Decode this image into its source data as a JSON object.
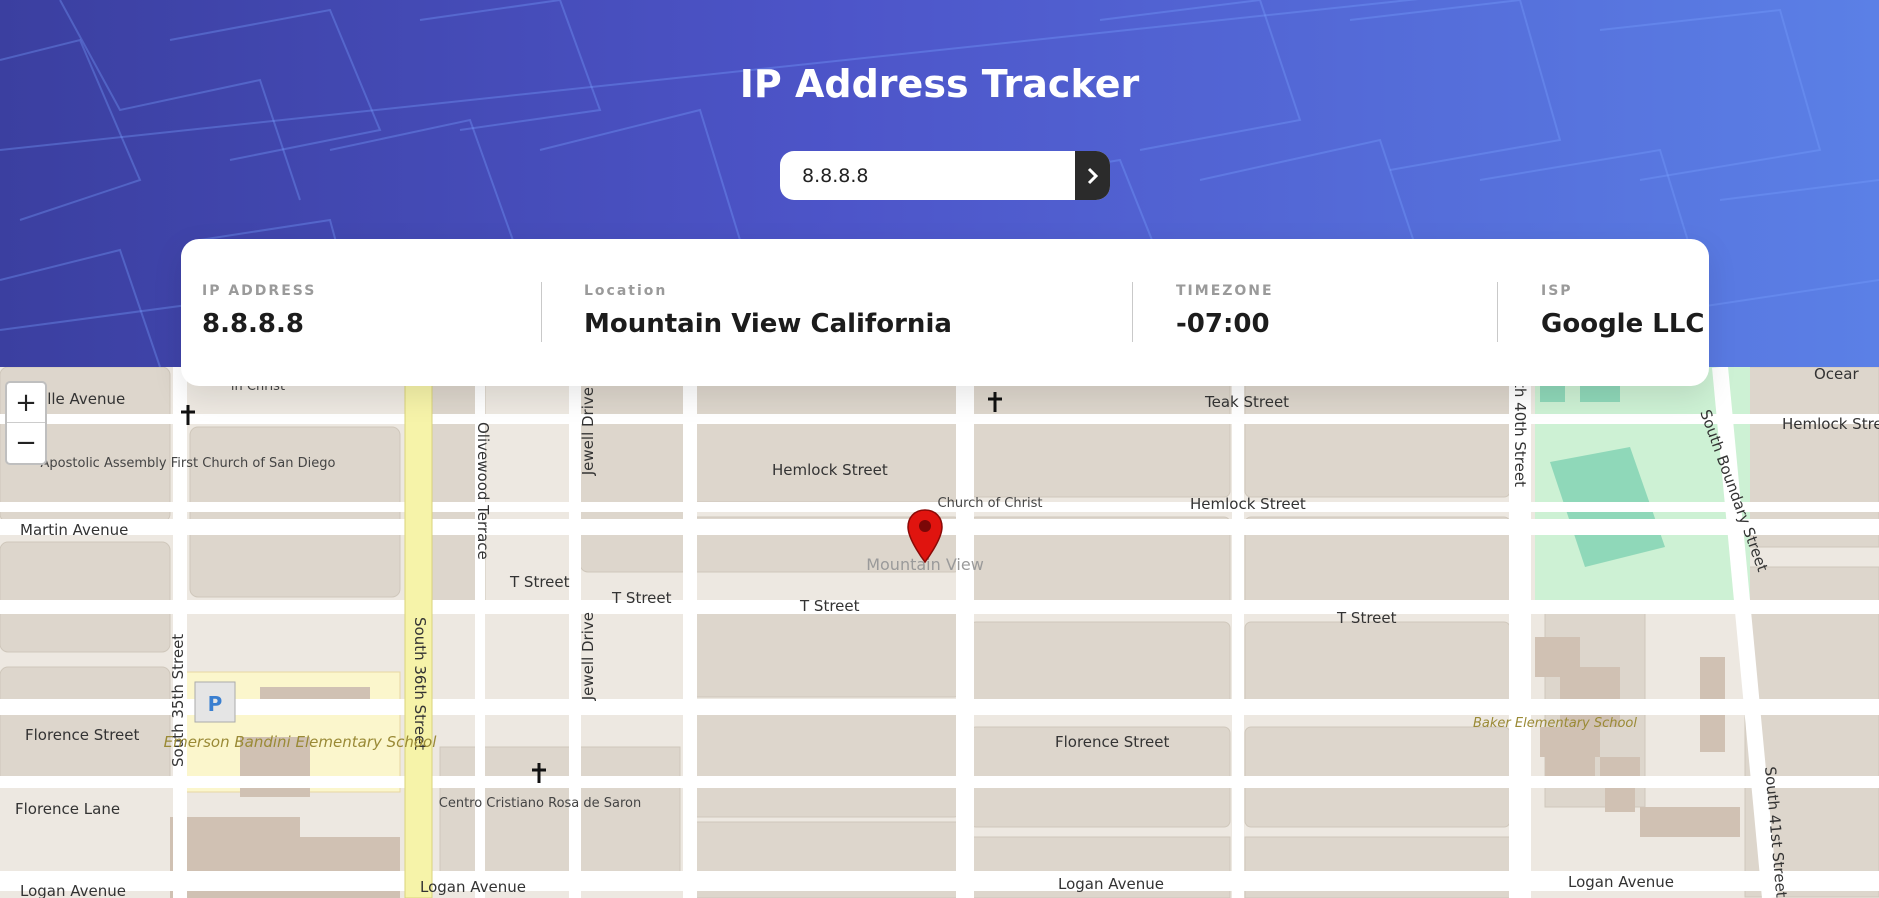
{
  "header": {
    "title": "IP Address Tracker",
    "search": {
      "value": "8.8.8.8",
      "button_icon": "chevron-right-icon"
    }
  },
  "info": {
    "ip": {
      "label": "IP ADDRESS",
      "value": "8.8.8.8"
    },
    "location": {
      "label": "Location",
      "value": "Mountain View California"
    },
    "timezone": {
      "label": "TIMEZONE",
      "value": "-07:00"
    },
    "isp": {
      "label": "ISP",
      "value": "Google LLC"
    }
  },
  "map": {
    "zoom_in": "+",
    "zoom_out": "−",
    "marker_icon": "map-pin-icon",
    "streets": {
      "teak": "Teak Street",
      "hemlock_1": "Hemlock Street",
      "hemlock_2": "Hemlock Street",
      "hemlock_3": "Hemlock Stre",
      "t_1": "T Street",
      "t_2": "T Street",
      "t_3": "T Street",
      "t_4": "T Street",
      "florence_1": "Florence Street",
      "florence_2": "Florence Street",
      "florence_lane": "Florence Lane",
      "logan_1": "Logan Avenue",
      "logan_2": "Logan Avenue",
      "logan_3": "Logan Avenue",
      "logan_4": "Logan Avenue",
      "martin": "Martin Avenue",
      "valle": "alle Avenue",
      "olivewood": "Olivewood Terrace",
      "jewell_1": "Jewell Drive",
      "jewell_2": "Jewell Drive",
      "s36": "South 36th Street",
      "s35": "South 35th Street",
      "s40": "th 40th Street",
      "boundary": "South Boundary Street",
      "s41": "South 41st Street",
      "ocean": "Ocear"
    },
    "places": {
      "apostolic": "Apostolic Assembly First Church of San Diego",
      "church_christ": "Church of Christ",
      "emerson": "Emerson Bandini Elementary School",
      "centro": "Centro Cristiano Rosa de Saron",
      "baker": "Baker Elementary School",
      "mountain_view": "Mountain View",
      "in_christ": "in Christ"
    },
    "colors": {
      "land": "#ede8e1",
      "block": "#ddd6cc",
      "road": "#ffffff",
      "highway": "#f6f3a9",
      "school": "#fbf6cc",
      "park": "#cdf1d4",
      "field": "#8fd8b9",
      "marker": "#e0140f"
    }
  }
}
